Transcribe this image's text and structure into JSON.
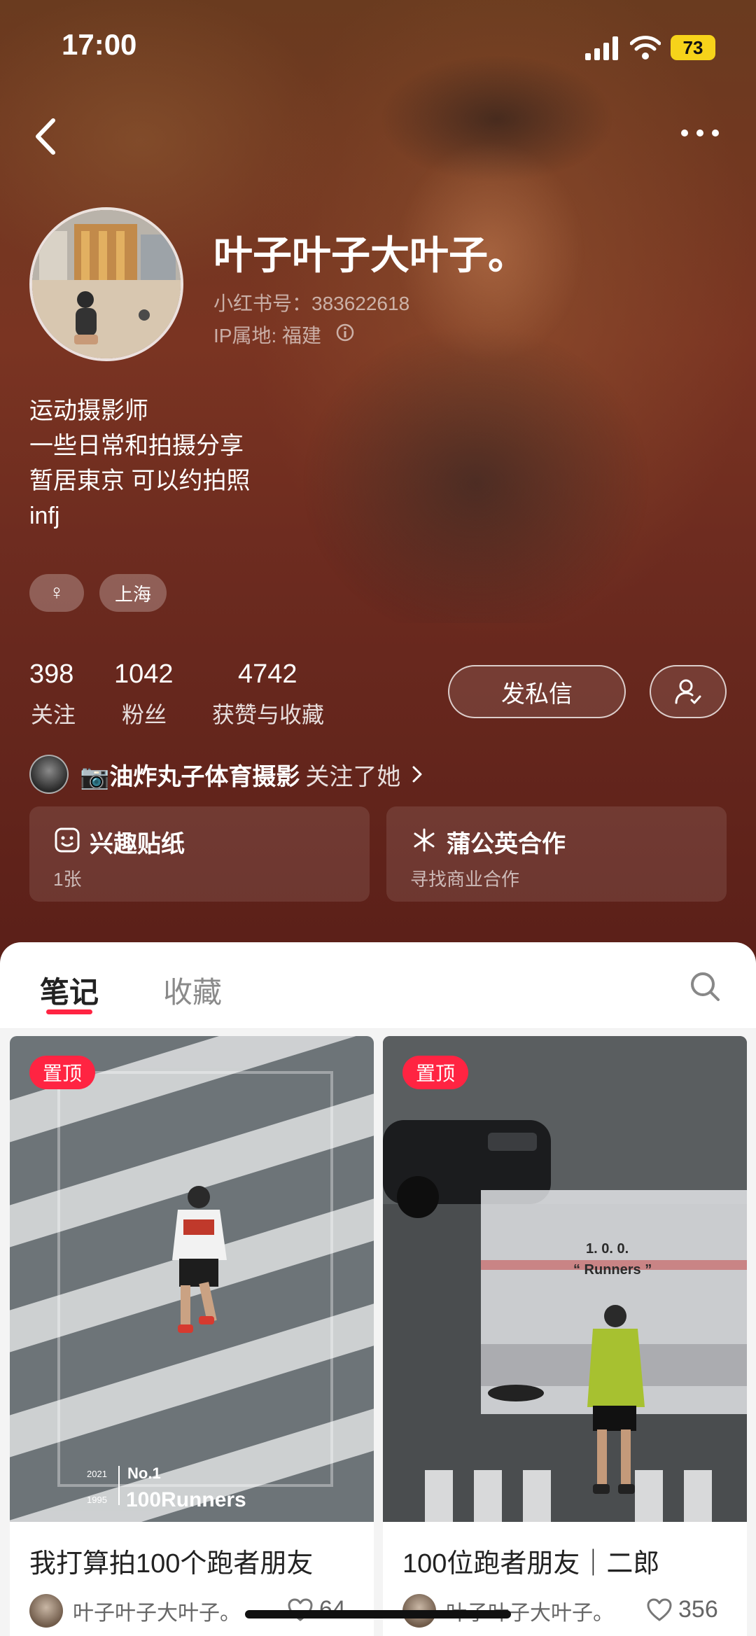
{
  "status_bar": {
    "time": "17:00",
    "battery": "73"
  },
  "profile": {
    "nickname": "叶子叶子大叶子。",
    "red_id": "小红书号：383622618",
    "ip_location": "IP属地: 福建",
    "bio": [
      "运动摄影师",
      "一些日常和拍摄分享",
      "暂居東京 可以约拍照",
      "infj"
    ],
    "tags": [
      {
        "icon": "female-icon",
        "label": "♀"
      },
      {
        "label": "上海"
      }
    ]
  },
  "stats": [
    {
      "value": "398",
      "label": "关注"
    },
    {
      "value": "1042",
      "label": "粉丝"
    },
    {
      "value": "4742",
      "label": "获赞与收藏"
    }
  ],
  "actions": {
    "message_label": "发私信",
    "follow_icon": "user-check-icon"
  },
  "mutual": {
    "name": "📷油炸丸子体育摄影",
    "suffix": "关注了她"
  },
  "cards": [
    {
      "icon": "sticker-icon",
      "title": "兴趣贴纸",
      "subtitle": "1张"
    },
    {
      "icon": "dandelion-icon",
      "title": "蒲公英合作",
      "subtitle": "寻找商业合作"
    }
  ],
  "tabs": [
    {
      "label": "笔记",
      "active": true
    },
    {
      "label": "收藏",
      "active": false
    }
  ],
  "notes": [
    {
      "badge": "置顶",
      "title": "我打算拍100个跑者朋友",
      "author": "叶子叶子大叶子。",
      "likes": "64",
      "image_text": {
        "brand": "No.1",
        "caption": "100Runners",
        "year_top": "2021",
        "year_bottom": "1995"
      }
    },
    {
      "badge": "置顶",
      "title": "100位跑者朋友｜二郎",
      "author": "叶子叶子大叶子。",
      "likes": "356",
      "image_text": {
        "van_line1": "1. 0. 0.",
        "van_line2": "“ Runners ”"
      }
    }
  ],
  "colors": {
    "accent": "#ff2442",
    "header_bg": "#6b2a1f"
  }
}
